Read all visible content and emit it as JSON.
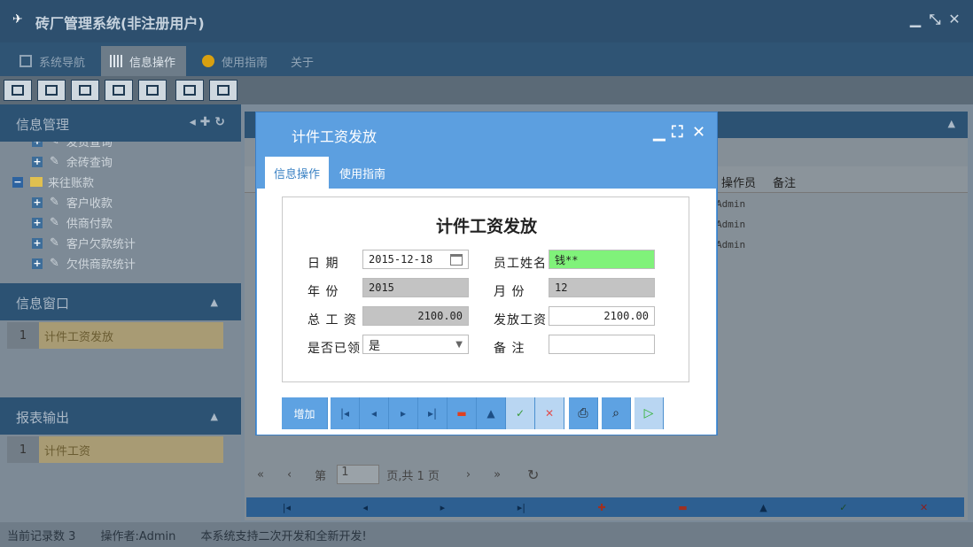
{
  "app": {
    "title": "砖厂管理系统(非注册用户)"
  },
  "menu": {
    "tabs": [
      {
        "label": "系统导航"
      },
      {
        "label": "信息操作"
      },
      {
        "label": "使用指南"
      },
      {
        "label": "关于"
      }
    ]
  },
  "sidebar": {
    "info_mgmt": {
      "title": "信息管理",
      "items": [
        {
          "label": "发货查询"
        },
        {
          "label": "余砖查询"
        },
        {
          "label": "来往账款"
        },
        {
          "label": "客户收款"
        },
        {
          "label": "供商付款"
        },
        {
          "label": "客户欠款统计"
        },
        {
          "label": "欠供商款统计"
        }
      ]
    },
    "info_window": {
      "title": "信息窗口",
      "items": [
        {
          "num": "1",
          "label": "计件工资发放"
        }
      ]
    },
    "report": {
      "title": "报表输出",
      "items": [
        {
          "num": "1",
          "label": "计件工资"
        }
      ]
    }
  },
  "grid": {
    "columns": [
      "操作员",
      "备注"
    ],
    "rows": [
      "Admin",
      "Admin",
      "Admin"
    ],
    "pager": {
      "page_prefix": "第",
      "page_value": "1",
      "page_suffix": "页,共 1 页"
    }
  },
  "status": {
    "record_count": "当前记录数 3",
    "operator": "操作者:Admin",
    "note": "本系统支持二次开发和全新开发!"
  },
  "dialog": {
    "title": "计件工资发放",
    "tabs": [
      {
        "label": "信息操作"
      },
      {
        "label": "使用指南"
      }
    ],
    "form": {
      "title": "计件工资发放",
      "date_label": "日 期",
      "date_value": "2015-12-18",
      "employee_label": "员工姓名",
      "employee_value": "钱**",
      "year_label": "年 份",
      "year_value": "2015",
      "month_label": "月 份",
      "month_value": "12",
      "total_label": "总 工 资",
      "total_value": "2100.00",
      "paid_label": "发放工资",
      "paid_value": "2100.00",
      "received_label": "是否已领",
      "received_value": "是",
      "remark_label": "备 注",
      "remark_value": ""
    },
    "buttons": {
      "add_label": "增加"
    }
  },
  "colors": {
    "accent": "#5c9fe0",
    "header": "#2c5273",
    "highlight": "#80f27a"
  }
}
